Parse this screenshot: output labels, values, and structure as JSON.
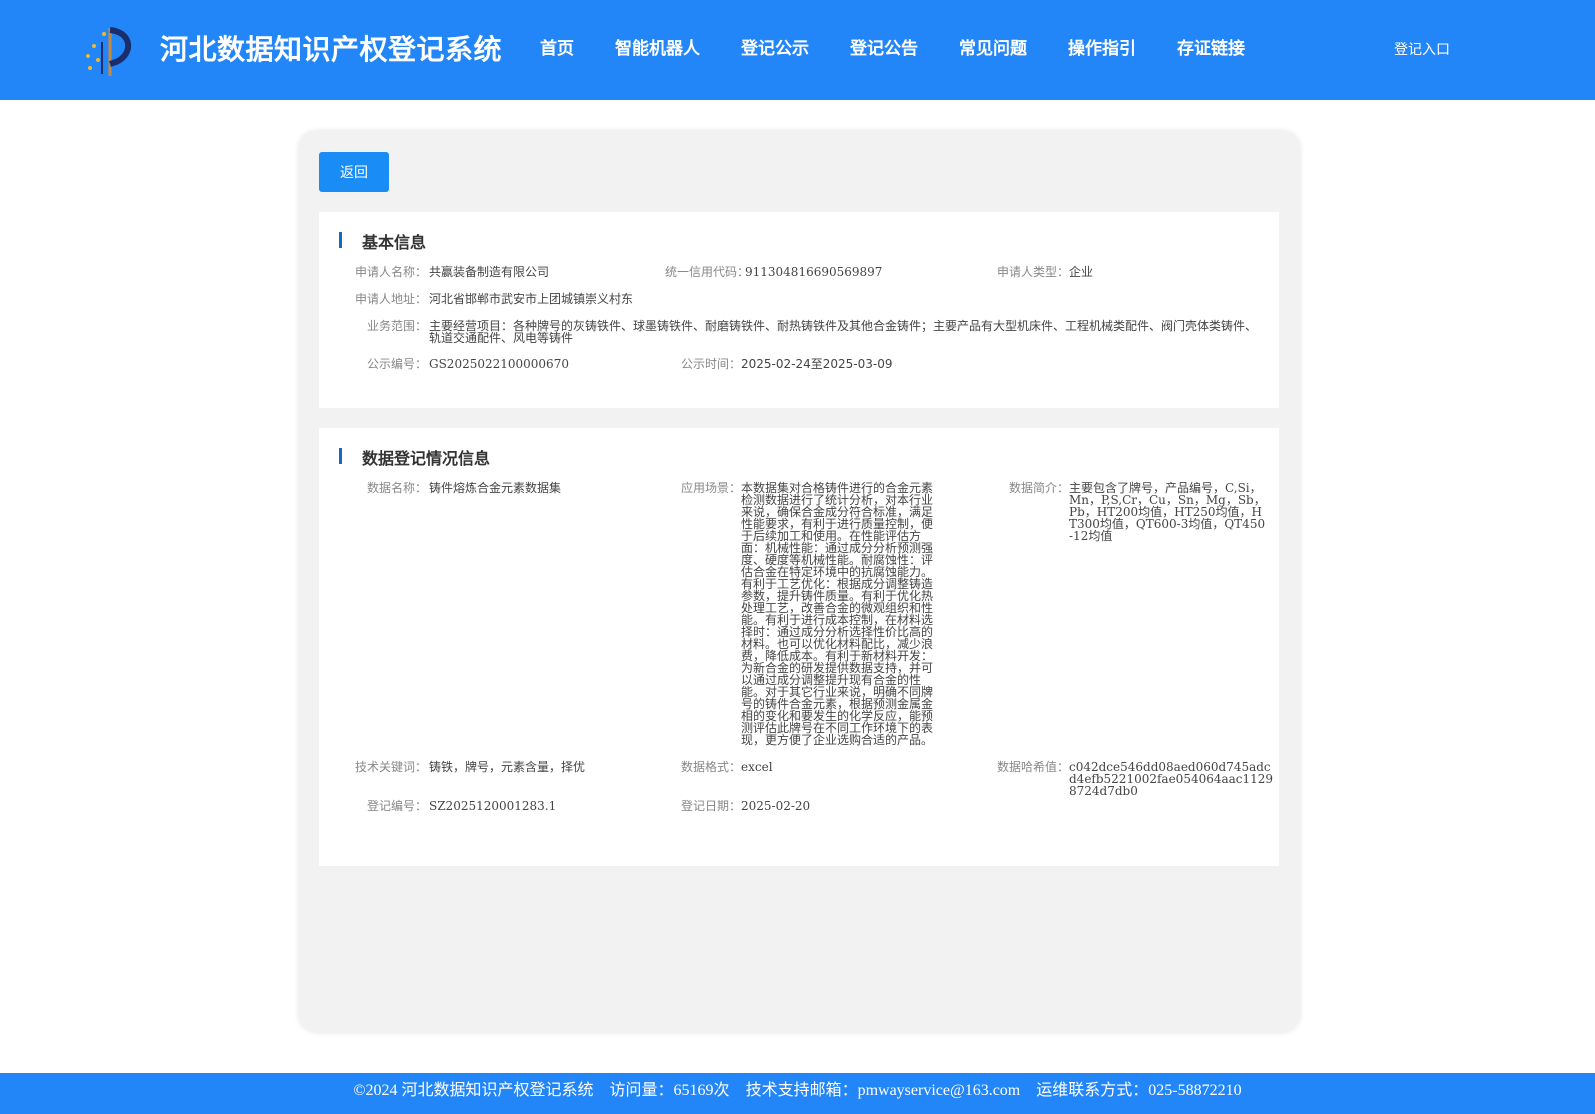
{
  "header": {
    "title": "河北数据知识产权登记系统",
    "nav": [
      "首页",
      "智能机器人",
      "登记公示",
      "登记公告",
      "常见问题",
      "操作指引",
      "存证链接"
    ],
    "login": "登记入口"
  },
  "back_label": "返回",
  "basic": {
    "title": "基本信息",
    "applicant_name_label": "申请人名称：",
    "applicant_name": "共赢装备制造有限公司",
    "credit_code_label": "统一信用代码：",
    "credit_code": "911304816690569897",
    "applicant_type_label": "申请人类型：",
    "applicant_type": "企业",
    "address_label": "申请人地址：",
    "address": "河北省邯郸市武安市上团城镇崇义村东",
    "scope_label": "业务范围：",
    "scope": "主要经营项目：各种牌号的灰铸铁件、球墨铸铁件、耐磨铸铁件、耐热铸铁件及其他合金铸件；主要产品有大型机床件、工程机械类配件、阀门壳体类铸件、轨道交通配件、风电等铸件",
    "pub_no_label": "公示编号：",
    "pub_no": "GS2025022100000670",
    "pub_time_label": "公示时间：",
    "pub_time": "2025-02-24至2025-03-09"
  },
  "data_reg": {
    "title": "数据登记情况信息",
    "name_label": "数据名称：",
    "name": "铸件熔炼合金元素数据集",
    "scene_label": "应用场景：",
    "scene": "本数据集对合格铸件进行的合金元素检测数据进行了统计分析，对本行业来说，确保合金成分符合标准，满足性能要求，有利于进行质量控制，便于后续加工和使用。在性能评估方面：机械性能：通过成分分析预测强度、硬度等机械性能。耐腐蚀性：评估合金在特定环境中的抗腐蚀能力。有利于工艺优化：根据成分调整铸造参数，提升铸件质量。有利于优化热处理工艺，改善合金的微观组织和性能。有利于进行成本控制，在材料选择时：通过成分分析选择性价比高的材料。也可以优化材料配比，减少浪费，降低成本。有利于新材料开发：为新合金的研发提供数据支持，并可以通过成分调整提升现有合金的性能。对于其它行业来说，明确不同牌号的铸件合金元素，根据预测金属金相的变化和要发生的化学反应，能预测评估此牌号在不同工作环境下的表现，更方便了企业选购合适的产品。",
    "intro_label": "数据简介：",
    "intro": "主要包含了牌号，产品编号，C,Si，Mn，P,S,Cr，Cu，Sn，Mg，Sb，Pb，HT200均值，HT250均值，HT300均值，QT600-3均值，QT450-12均值",
    "keywords_label": "技术关键词：",
    "keywords": "铸铁，牌号，元素含量，择优",
    "format_label": "数据格式：",
    "format": "excel",
    "hash_label": "数据哈希值：",
    "hash": "c042dce546dd08aed060d745adcd4efb5221002fae054064aac11298724d7db0",
    "reg_no_label": "登记编号：",
    "reg_no": "SZ2025120001283.1",
    "reg_date_label": "登记日期：",
    "reg_date": "2025-02-20"
  },
  "footer": {
    "copyright": "©2024 河北数据知识产权登记系统",
    "visits": "访问量：65169次",
    "email": "技术支持邮箱：pmwayservice@163.com",
    "phone": "运维联系方式：025-58872210"
  }
}
